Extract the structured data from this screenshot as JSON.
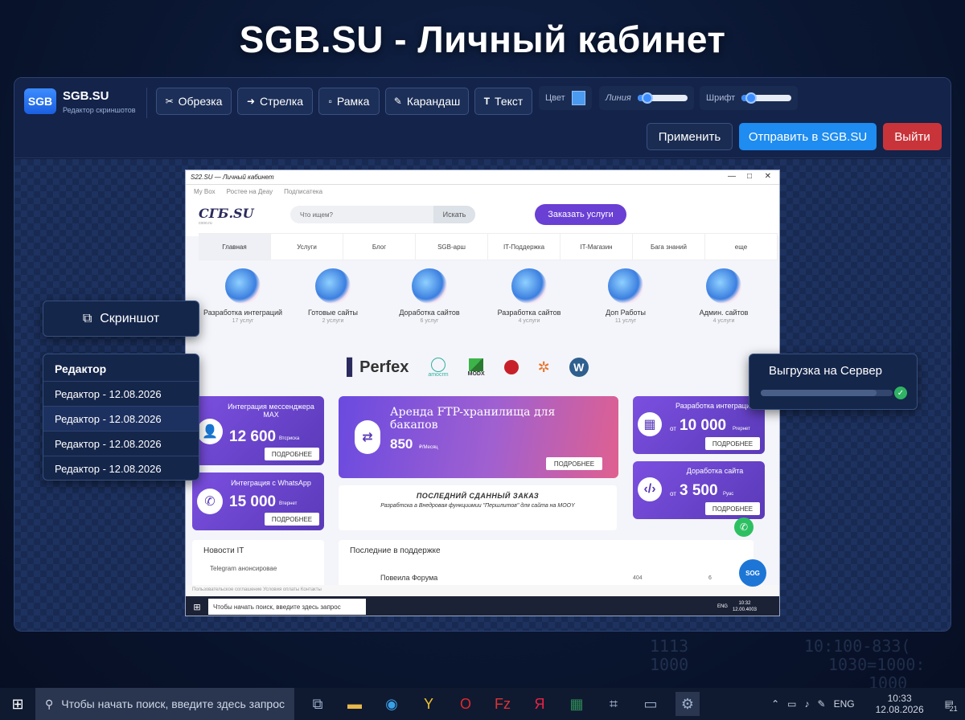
{
  "hero_title": "SGB.SU - Личный кабинет",
  "app": {
    "logo": "SGB",
    "brand": "SGB.SU",
    "subtitle": "Редактор скриншотов"
  },
  "tools": [
    {
      "label": "Обрезка",
      "icon": "scissors-icon"
    },
    {
      "label": "Стрелка",
      "icon": "arrow-right-icon"
    },
    {
      "label": "Рамка",
      "icon": "square-icon"
    },
    {
      "label": "Карандаш",
      "icon": "pencil-icon"
    },
    {
      "label": "Текст",
      "icon": "text-icon"
    }
  ],
  "controls": {
    "color_label": "Цвет",
    "color_value": "#4a9bf0",
    "line_label": "Линия",
    "line_level": 0.18,
    "font_label": "Шрифт",
    "font_level": 0.18
  },
  "actions": {
    "apply": "Применить",
    "send": "Отправить в SGB.SU",
    "exit": "Выйти"
  },
  "screenshot_button": "Скриншот",
  "editor_panel": {
    "title": "Редактор",
    "items": [
      "Редактор - 12.08.2026",
      "Редактор - 12.08.2026",
      "Редактор - 12.08.2026",
      "Редактор - 12.08.2026"
    ]
  },
  "upload_panel": {
    "title": "Выгрузка на Сервер",
    "progress": 0.88
  },
  "site": {
    "window_title": "S22.SU — Личный кабинет",
    "topline": [
      "My Box",
      "Ростее на Деау",
      "Подписатека"
    ],
    "logo": "СГБ.SU",
    "logo_sub": "cooo.ru",
    "search_placeholder": "Что ищем?",
    "search_button": "Искать",
    "order_button": "Заказать услуги",
    "nav": [
      "Главная",
      "Услуги",
      "Блог",
      "SGB-apш",
      "IT-Поддержка",
      "IT-Магазин",
      "Бага знаний",
      "еще"
    ],
    "categories": [
      {
        "name": "Разработка интеграций",
        "count": "17 услуг"
      },
      {
        "name": "Готовые сайты",
        "count": "2 услуги"
      },
      {
        "name": "Доработка сайтов",
        "count": "6 услуг"
      },
      {
        "name": "Разработка сайтов",
        "count": "4 услуги"
      },
      {
        "name": "Доп Работы",
        "count": "11 услуг"
      },
      {
        "name": "Админ. сайтов",
        "count": "4 услуги"
      }
    ],
    "brands": {
      "perfex": "Perfex",
      "amocrm": "amocrm",
      "modx": "MODX"
    },
    "card_max": {
      "title": "Интеграция мессенджера MAX",
      "price": "12 600",
      "unit": "Втсриска",
      "more": "ПОДРОБНЕЕ"
    },
    "card_ftp": {
      "title": "Аренда FTP-хранилища для бакапов",
      "price": "850",
      "unit": "₽/Месяц",
      "more": "ПОДРОБНЕЕ"
    },
    "card_int": {
      "title": "Разработка интеграций",
      "from": "от",
      "price": "10 000",
      "unit": "Ргернет",
      "more": "ПОДРОБНЕЕ"
    },
    "card_wa": {
      "title": "Интеграция с WhatsApp",
      "price": "15 000",
      "unit": "Втернет",
      "more": "ПОДРОБНЕЕ"
    },
    "card_dev": {
      "title": "Доработка сайта",
      "from": "от",
      "price": "3 500",
      "unit": "Руас",
      "more": "ПОДРОБНЕЕ"
    },
    "last_order": {
      "title": "ПОСЛЕДНИЙ СДАННЫЙ ЗАКАЗ",
      "text": "Разрабтска а Внедровая функциимии \"Першлитов\" для сайта на MOOY"
    },
    "news": {
      "title": "Новости IT",
      "item": "Telegram анонсировае"
    },
    "support": {
      "title": "Последние в поддержке",
      "item": "Повеила Форума",
      "v1": "404",
      "v2": "6"
    },
    "footer": "Пользовательское соглашение   Условия оплаты   Контакты",
    "chat_badge": "SOG",
    "task_search": "Чтобы начать поиск, введите здесь запрос",
    "task_time": "10:32",
    "task_date": "12.00.4003",
    "task_lang": "ENG"
  },
  "taskbar": {
    "search": "Чтобы начать поиск, введите здесь запрос",
    "lang": "ENG",
    "time": "10:33",
    "date": "12.08.2026",
    "notif": "21"
  },
  "bg_numbers": [
    "1113",
    "1000",
    "10:100-833(",
    "1030=1000:",
    "1000"
  ]
}
